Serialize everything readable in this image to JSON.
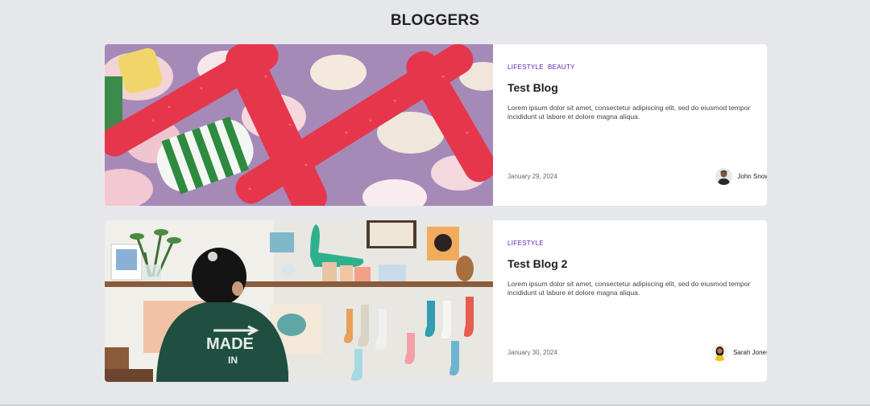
{
  "page": {
    "title": "BLOGGERS"
  },
  "posts": [
    {
      "tags": [
        "LIFESTYLE",
        "BEAUTY"
      ],
      "title": "Test Blog",
      "excerpt": "Lorem ipsum dolor sit amet, consectetur adipiscing elit, sed do eiusmod tempor incididunt ut labore et dolore magna aliqua.",
      "date": "January 29, 2024",
      "author": "John Snow",
      "image": "candy-photo"
    },
    {
      "tags": [
        "LIFESTYLE"
      ],
      "title": "Test Blog 2",
      "excerpt": "Lorem ipsum dolor sit amet, consectetur adipiscing elit, sed do eiusmod tempor incididunt ut labore et dolore magna aliqua.",
      "date": "January 30, 2024",
      "author": "Sarah Jones",
      "image": "shop-photo"
    }
  ],
  "colors": {
    "background": "#e6e7eb",
    "card": "#ffffff",
    "tag": "#5b1fb8"
  }
}
